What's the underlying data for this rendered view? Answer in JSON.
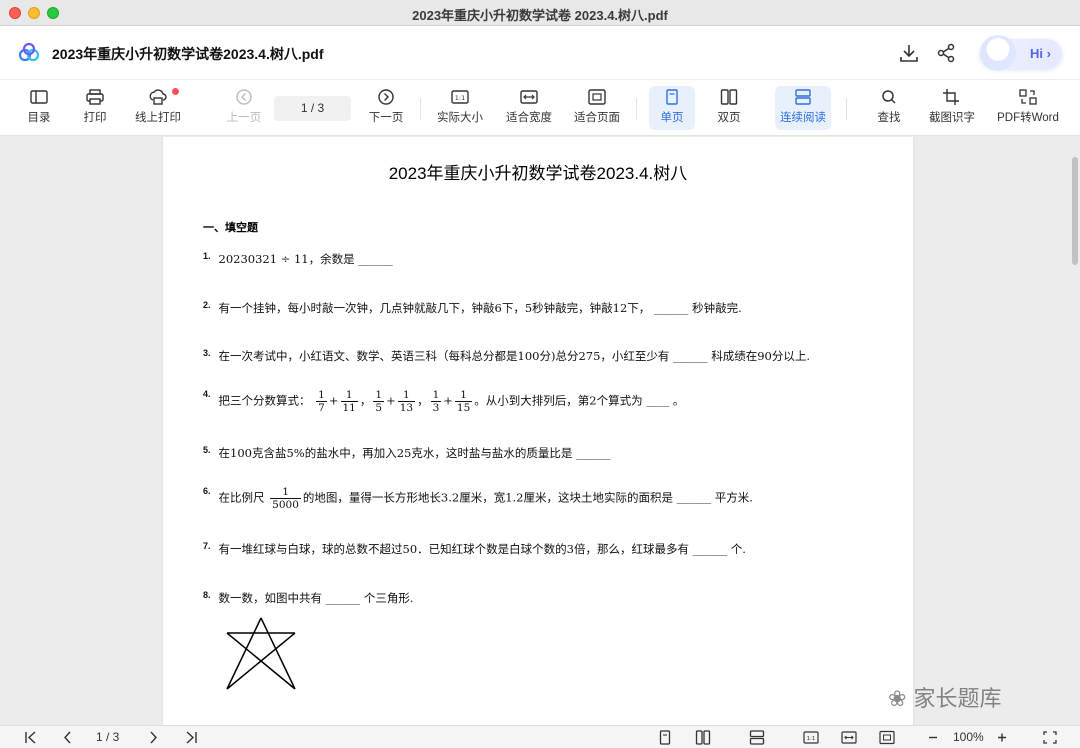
{
  "window": {
    "title": "2023年重庆小升初数学试卷 2023.4.树八.pdf"
  },
  "header": {
    "doc_title": "2023年重庆小升初数学试卷2023.4.树八.pdf",
    "assistant_label": "Hi"
  },
  "toolbar": {
    "toc": "目录",
    "print": "打印",
    "online_print": "线上打印",
    "prev": "上一页",
    "page_indicator": "1  /  3",
    "next": "下一页",
    "actual_size": "实际大小",
    "fit_width": "适合宽度",
    "fit_page": "适合页面",
    "single": "单页",
    "double": "双页",
    "continuous": "连续阅读",
    "find": "查找",
    "ocr": "截图识字",
    "to_word": "PDF转Word"
  },
  "document": {
    "title": "2023年重庆小升初数学试卷2023.4.树八",
    "section": "一、填空题",
    "questions": [
      {
        "n": "1.",
        "text": "20230321 ÷ 11，余数是 ______"
      },
      {
        "n": "2.",
        "text": "有一个挂钟，每小时敲一次钟，几点钟就敲几下，钟敲6下，5秒钟敲完，钟敲12下， ______ 秒钟敲完."
      },
      {
        "n": "3.",
        "text": "在一次考试中，小红语文、数学、英语三科（每科总分都是100分)总分275，小红至少有 ______ 科成绩在90分以上."
      },
      {
        "n": "4.",
        "pre": "把三个分数算式：",
        "mid": "。从小到大排列后，第2个算式为 ____ 。"
      },
      {
        "n": "5.",
        "text": "在100克含盐5%的盐水中，再加入25克水，这时盐与盐水的质量比是 ______"
      },
      {
        "n": "6.",
        "pre": "在比例尺",
        "frac_n": "1",
        "frac_d": "5000",
        "post": "的地图，量得一长方形地长3.2厘米，宽1.2厘米，这块土地实际的面积是 ______ 平方米."
      },
      {
        "n": "7.",
        "text": "有一堆红球与白球，球的总数不超过50．已知红球个数是白球个数的3倍，那么，红球最多有 ______ 个."
      },
      {
        "n": "8.",
        "text": "数一数，如图中共有 ______ 个三角形."
      }
    ],
    "fractions": [
      "1",
      "7",
      "1",
      "11",
      "1",
      "5",
      "1",
      "13",
      "1",
      "3",
      "1",
      "15"
    ]
  },
  "bottom": {
    "page_indicator": "1  /  3",
    "zoom": "100%"
  },
  "watermark": "家长题库",
  "colors": {
    "accent": "#2f6fe0",
    "active_bg": "#e8f0fc",
    "notify": "#ff4d5a"
  }
}
